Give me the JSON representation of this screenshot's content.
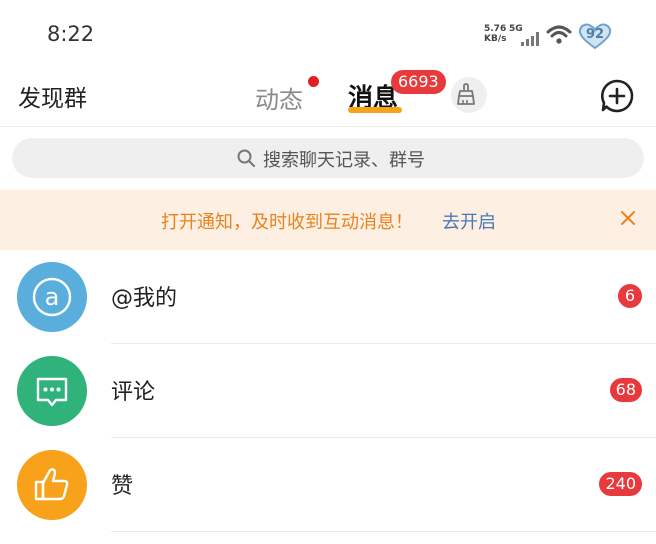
{
  "status_bar": {
    "time": "8:22",
    "net_speed_value": "5.76",
    "net_speed_unit": "KB/s",
    "network_type": "5G",
    "battery": "92"
  },
  "header": {
    "discover_groups": "发现群",
    "tabs": [
      {
        "label": "动态",
        "has_dot": true
      },
      {
        "label": "消息",
        "badge": "6693",
        "active": true
      }
    ],
    "accent_color": "#f4a41a"
  },
  "search": {
    "placeholder": "搜索聊天记录、群号"
  },
  "notice": {
    "text": "打开通知，及时收到互动消息！",
    "link": "去开启"
  },
  "list": [
    {
      "label": "@我的",
      "count": "6",
      "icon": "at-icon",
      "color": "#5aaedb"
    },
    {
      "label": "评论",
      "count": "68",
      "icon": "comment-icon",
      "color": "#2fb37a"
    },
    {
      "label": "赞",
      "count": "240",
      "icon": "thumbs-up-icon",
      "color": "#f7a21a"
    }
  ]
}
